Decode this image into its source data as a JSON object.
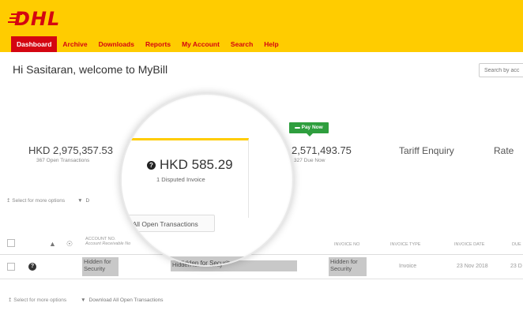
{
  "brand": {
    "logo_text": "DHL",
    "primary_color": "#ffcc00",
    "accent_color": "#d40511"
  },
  "nav": {
    "items": [
      {
        "label": "Dashboard",
        "active": true
      },
      {
        "label": "Archive"
      },
      {
        "label": "Downloads"
      },
      {
        "label": "Reports"
      },
      {
        "label": "My Account"
      },
      {
        "label": "Search"
      },
      {
        "label": "Help"
      }
    ]
  },
  "welcome": "Hi Sasitaran, welcome to MyBill",
  "search": {
    "placeholder": "Search by acc"
  },
  "tiles": {
    "open": {
      "amount": "HKD 2,975,357.53",
      "sub": "367 Open Transactions"
    },
    "disputed": {
      "amount": "HKD 585.29",
      "sub": "1 Disputed Invoice"
    },
    "due": {
      "amount": "D 2,571,493.75",
      "sub": "327 Due Now",
      "paynow": "Pay Now"
    },
    "tariff": "Tariff Enquiry",
    "rate": "Rate"
  },
  "options": {
    "select_label": "Select for more options",
    "download_short": "D",
    "download_label": "Download All Open Transactions",
    "download_partial": "d All Open Transactions"
  },
  "table": {
    "headers": {
      "account": "ACCOUNT NO.",
      "account_sub": "Account Receivable No",
      "invoice_no": "INVOICE NO",
      "invoice_type": "INVOICE TYPE",
      "invoice_date": "INVOICE DATE",
      "due": "DUE"
    },
    "row": {
      "account": "Hidden for Security",
      "name": "Hidden for Security",
      "invoice_no": "Hidden for Security",
      "invoice_type": "Invoice",
      "invoice_date": "23 Nov 2018",
      "due": "23 D"
    }
  }
}
